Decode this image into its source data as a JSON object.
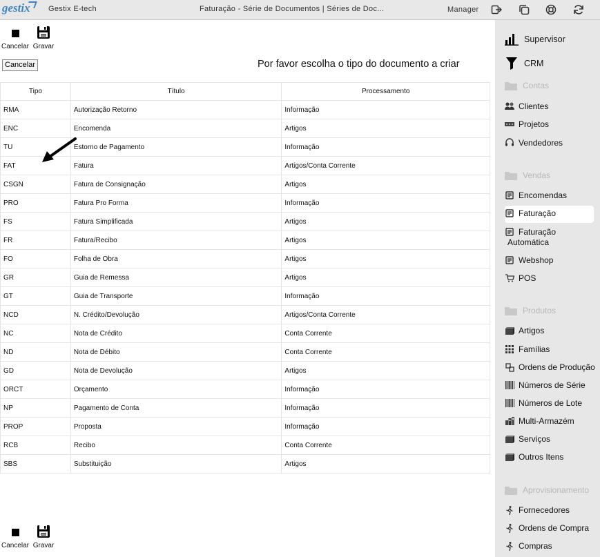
{
  "topbar": {
    "logo": "gestix",
    "company": "Gestix E-tech",
    "title": "Faturação - Série de Documentos | Séries de Doc...",
    "user": "Manager",
    "icons": [
      "logout-icon",
      "windows-icon",
      "help-lifebuoy-icon",
      "refresh-icon"
    ]
  },
  "toolbar": {
    "cancel_label": "Cancelar",
    "save_label": "Gravar"
  },
  "cancel_button": "Cancelar",
  "prompt": "Por favor escolha o tipo do documento a criar",
  "table": {
    "headers": [
      "Tipo",
      "Título",
      "Processamento"
    ],
    "rows": [
      [
        "RMA",
        "Autorização Retorno",
        "Informação"
      ],
      [
        "ENC",
        "Encomenda",
        "Artigos"
      ],
      [
        "TU",
        "Estorno de Pagamento",
        "Informação"
      ],
      [
        "FAT",
        "Fatura",
        "Artigos/Conta Corrente"
      ],
      [
        "CSGN",
        "Fatura de Consignação",
        "Artigos"
      ],
      [
        "PRO",
        "Fatura Pro Forma",
        "Informação"
      ],
      [
        "FS",
        "Fatura Simplificada",
        "Artigos"
      ],
      [
        "FR",
        "Fatura/Recibo",
        "Artigos"
      ],
      [
        "FO",
        "Folha de Obra",
        "Artigos"
      ],
      [
        "GR",
        "Guia de Remessa",
        "Artigos"
      ],
      [
        "GT",
        "Guia de Transporte",
        "Informação"
      ],
      [
        "NCD",
        "N. Crédito/Devolução",
        "Artigos/Conta Corrente"
      ],
      [
        "NC",
        "Nota de Crédito",
        "Conta Corrente"
      ],
      [
        "ND",
        "Nota de Débito",
        "Conta Corrente"
      ],
      [
        "GD",
        "Nota de Devolução",
        "Artigos"
      ],
      [
        "ORCT",
        "Orçamento",
        "Informação"
      ],
      [
        "NP",
        "Pagamento de Conta",
        "Informação"
      ],
      [
        "PROP",
        "Proposta",
        "Informação"
      ],
      [
        "RCB",
        "Recibo",
        "Conta Corrente"
      ],
      [
        "SBS",
        "Substituição",
        "Artigos"
      ]
    ]
  },
  "sidebar": {
    "supervisor": "Supervisor",
    "crm": "CRM",
    "contas": "Contas",
    "clientes": "Clientes",
    "projetos": "Projetos",
    "vendedores": "Vendedores",
    "vendas": "Vendas",
    "encomendas": "Encomendas",
    "faturacao": "Faturação",
    "faturacao_auto_1": "Faturação",
    "faturacao_auto_2": "Automática",
    "webshop": "Webshop",
    "pos": "POS",
    "produtos": "Produtos",
    "artigos": "Artigos",
    "familias": "Famílias",
    "ordens_producao": "Ordens de Produção",
    "numeros_serie": "Números de Série",
    "numeros_lote": "Números de Lote",
    "multi_armazem": "Multi-Armazém",
    "servicos": "Serviços",
    "outros_itens": "Outros Itens",
    "aprovisionamento": "Aprovisionamento",
    "fornecedores": "Fornecedores",
    "ordens_compra": "Ordens de Compra",
    "compras": "Compras"
  },
  "colors": {
    "logo": "#3a86c8",
    "topbar_bg": "#e8e8e8",
    "sidebar_bg": "#e7e7e7",
    "section_text": "#b8b8b8"
  }
}
